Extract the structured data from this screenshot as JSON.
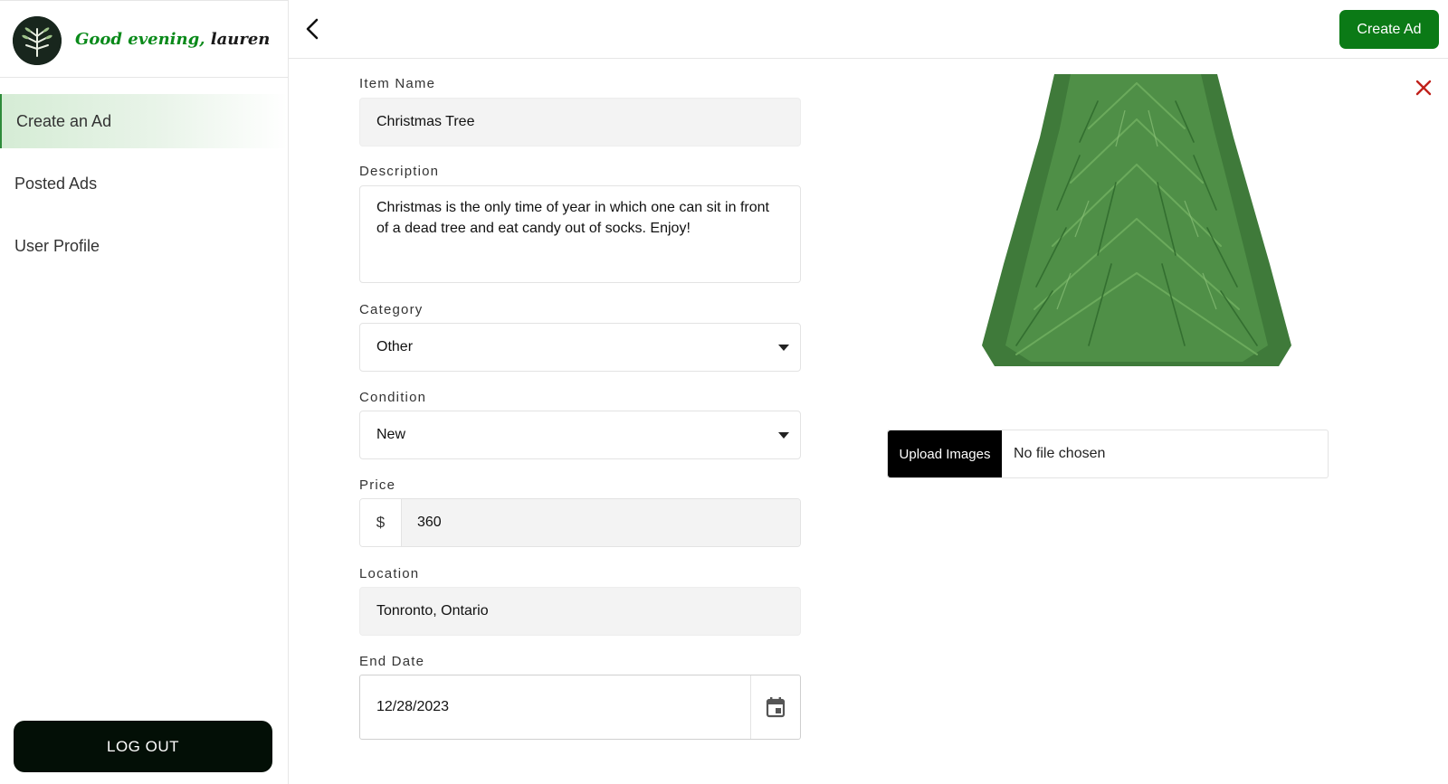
{
  "sidebar": {
    "greeting": "Good evening,",
    "user_name": "lauren",
    "nav_items": [
      {
        "label": "Create an Ad",
        "active": true
      },
      {
        "label": "Posted Ads",
        "active": false
      },
      {
        "label": "User Profile",
        "active": false
      }
    ],
    "logout_label": "LOG OUT"
  },
  "topbar": {
    "back_icon": "chevron-left-icon",
    "create_ad_label": "Create Ad"
  },
  "form": {
    "item_name": {
      "label": "Item Name",
      "value": "Christmas Tree"
    },
    "description": {
      "label": "Description",
      "value": "Christmas is the only time of year in which one can sit in front of a dead tree and eat candy out of socks. Enjoy!"
    },
    "category": {
      "label": "Category",
      "value": "Other"
    },
    "condition": {
      "label": "Condition",
      "value": "New"
    },
    "price": {
      "label": "Price",
      "currency": "$",
      "value": "360"
    },
    "location": {
      "label": "Location",
      "value": "Tonronto, Ontario"
    },
    "end_date": {
      "label": "End Date",
      "value": "12/28/2023"
    }
  },
  "upload": {
    "button_label": "Upload Images",
    "status": "No file chosen"
  },
  "colors": {
    "brand_green": "#0b7a16",
    "greeting_green": "#0a8a1a",
    "remove_red": "#c0201a",
    "logout_bg": "#030f06"
  }
}
